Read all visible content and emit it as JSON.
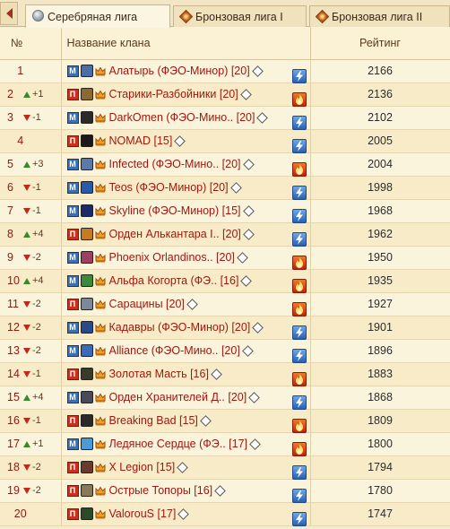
{
  "tabs": [
    {
      "label": "Серебряная лига",
      "icon": "silver-medal-icon",
      "active": true
    },
    {
      "label": "Бронзовая лига I",
      "icon": "bronze-medal-icon",
      "active": false
    },
    {
      "label": "Бронзовая лига II",
      "icon": "bronze-medal-icon",
      "active": false
    }
  ],
  "table": {
    "headers": {
      "num": "№",
      "name": "Название клана",
      "rating": "Рейтинг"
    },
    "rows": [
      {
        "pos": "1",
        "change": "",
        "dir": "",
        "badge": "М",
        "emblem": "#4a6ea8",
        "name": "Алатырь (ФЭО-Минор) [20]",
        "element": "lightning",
        "rating": "2166"
      },
      {
        "pos": "2",
        "change": "+1",
        "dir": "up",
        "badge": "П",
        "emblem": "#8a6a30",
        "name": "Старики-Разбойники [20]",
        "element": "fire",
        "rating": "2136"
      },
      {
        "pos": "3",
        "change": "-1",
        "dir": "down",
        "badge": "М",
        "emblem": "#2a2a2a",
        "name": "DarkOmen (ФЭО-Мино.. [20]",
        "element": "lightning",
        "rating": "2102"
      },
      {
        "pos": "4",
        "change": "",
        "dir": "",
        "badge": "П",
        "emblem": "#1a1a1a",
        "name": "NOMAD [15]",
        "element": "lightning",
        "rating": "2005"
      },
      {
        "pos": "5",
        "change": "+3",
        "dir": "up",
        "badge": "М",
        "emblem": "#5a7aa8",
        "name": "Infected (ФЭО-Мино.. [20]",
        "element": "fire",
        "rating": "2004"
      },
      {
        "pos": "6",
        "change": "-1",
        "dir": "down",
        "badge": "М",
        "emblem": "#2a5aa8",
        "name": "Teos (ФЭО-Минор) [20]",
        "element": "lightning",
        "rating": "1998"
      },
      {
        "pos": "7",
        "change": "-1",
        "dir": "down",
        "badge": "М",
        "emblem": "#1a2a6a",
        "name": "Skyline (ФЭО-Минор) [15]",
        "element": "lightning",
        "rating": "1968"
      },
      {
        "pos": "8",
        "change": "+4",
        "dir": "up",
        "badge": "П",
        "emblem": "#c87a20",
        "name": "Орден Алькантара I.. [20]",
        "element": "lightning",
        "rating": "1962"
      },
      {
        "pos": "9",
        "change": "-2",
        "dir": "down",
        "badge": "М",
        "emblem": "#a04060",
        "name": "Phoenix Orlandinos.. [20]",
        "element": "fire",
        "rating": "1950"
      },
      {
        "pos": "10",
        "change": "+4",
        "dir": "up",
        "badge": "М",
        "emblem": "#3a8a3a",
        "name": "Альфа Когорта (ФЭ.. [16]",
        "element": "fire",
        "rating": "1935"
      },
      {
        "pos": "11",
        "change": "-2",
        "dir": "down",
        "badge": "П",
        "emblem": "#7a8a9a",
        "name": "Сарацины [20]",
        "element": "fire",
        "rating": "1927"
      },
      {
        "pos": "12",
        "change": "-2",
        "dir": "down",
        "badge": "М",
        "emblem": "#2a4a8a",
        "name": "Кадавры (ФЭО-Минор) [20]",
        "element": "lightning",
        "rating": "1901"
      },
      {
        "pos": "13",
        "change": "-2",
        "dir": "down",
        "badge": "М",
        "emblem": "#3a6ab8",
        "name": "Alliance (ФЭО-Мино.. [20]",
        "element": "lightning",
        "rating": "1896"
      },
      {
        "pos": "14",
        "change": "-1",
        "dir": "down",
        "badge": "П",
        "emblem": "#3a3a2a",
        "name": "Золотая Масть [16]",
        "element": "fire",
        "rating": "1883"
      },
      {
        "pos": "15",
        "change": "+4",
        "dir": "up",
        "badge": "М",
        "emblem": "#4a4a5a",
        "name": "Орден Хранителей Д.. [20]",
        "element": "lightning",
        "rating": "1868"
      },
      {
        "pos": "16",
        "change": "-1",
        "dir": "down",
        "badge": "П",
        "emblem": "#2a2a2a",
        "name": "Breaking Bad [15]",
        "element": "fire",
        "rating": "1809"
      },
      {
        "pos": "17",
        "change": "+1",
        "dir": "up",
        "badge": "М",
        "emblem": "#4a9ad8",
        "name": "Ледяное Сердце (ФЭ.. [17]",
        "element": "fire",
        "rating": "1800"
      },
      {
        "pos": "18",
        "change": "-2",
        "dir": "down",
        "badge": "П",
        "emblem": "#6a3a2a",
        "name": "X Legion [15]",
        "element": "lightning",
        "rating": "1794"
      },
      {
        "pos": "19",
        "change": "-2",
        "dir": "down",
        "badge": "П",
        "emblem": "#8a7a5a",
        "name": "Острые Топоры [16]",
        "element": "lightning",
        "rating": "1780"
      },
      {
        "pos": "20",
        "change": "",
        "dir": "",
        "badge": "П",
        "emblem": "#2a4a2a",
        "name": "ValorouS [17]",
        "element": "lightning",
        "rating": "1747"
      }
    ]
  }
}
